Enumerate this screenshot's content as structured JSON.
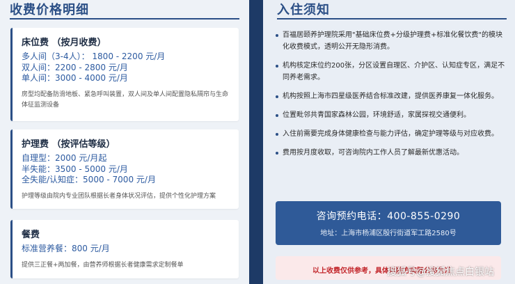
{
  "left": {
    "title": "收费价格明细",
    "cards": [
      {
        "heading": "床位费 （按月收费）",
        "lines": [
          "多人间（3-4人）： 1800 - 2200 元/月",
          "双人间：2200 - 2800 元/月",
          "单人间：3000 - 4000 元/月"
        ],
        "note": "房型均配备防滑地板、紧急呼叫装置，双人间及单人间配置隐私隔帘与生命体征监测设备"
      },
      {
        "heading": "护理费 （按评估等级）",
        "lines": [
          "自理型：2000 元/月起",
          "半失能：3500 - 5000 元/月",
          "全失能/认知症：5000 - 7000 元/月"
        ],
        "note": "护理等级由院内专业团队根据长者身体状况评估，提供个性化护理方案"
      },
      {
        "heading": "餐费",
        "lines": [
          "标准营养餐：800 元/月"
        ],
        "note": "提供三正餐+两加餐，由营养师根据长者健康需求定制餐单"
      }
    ]
  },
  "right": {
    "title": "入住须知",
    "items": [
      "百福居颐养护理院采用\"基础床位费+分级护理费+标准化餐饮费\"的模块化收费模式，透明公开无隐形消费。",
      "机构核定床位约200张，分区设置自理区、介护区、认知症专区，满足不同养老需求。",
      "机构按照上海市四星级医养结合标准改建，提供医养康复一体化服务。",
      "位置毗邻共青国家森林公园，环境舒适，家属探视交通便利。",
      "入住前需要完成身体健康检查与能力评估，确定护理等级与对应收费。",
      "费用按月度收取，可咨询院内工作人员了解最新优惠活动。"
    ],
    "contact": {
      "phone": "咨询预约电话：400-855-0290",
      "address": "地址：上海市杨浦区殷行街道军工路2580号"
    },
    "disclaimer": "以上收费仅供参考，具体以院方实际公布为准"
  },
  "watermark": "搜狐号@搜狐焦点白银站"
}
